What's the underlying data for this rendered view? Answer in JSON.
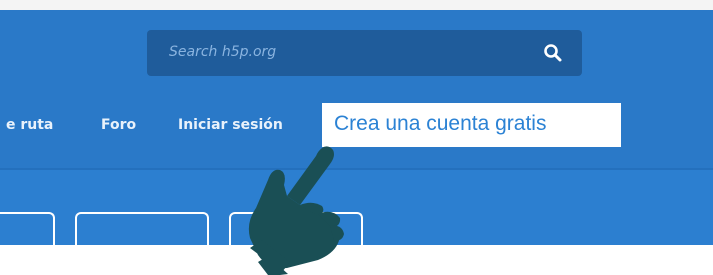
{
  "search": {
    "placeholder": "Search h5p.org",
    "icon": "search-icon"
  },
  "nav": {
    "items": [
      {
        "label": "e ruta"
      },
      {
        "label": "Foro"
      },
      {
        "label": "Iniciar sesión"
      }
    ]
  },
  "callout": {
    "label": "Crea una cuenta gratis"
  },
  "colors": {
    "nav_background": "#2a79c8",
    "search_background": "#1f5c9b",
    "callout_text": "#2b82d4",
    "hand": "#1a4f55"
  },
  "pointer": {
    "icon": "pointing-hand-icon"
  }
}
